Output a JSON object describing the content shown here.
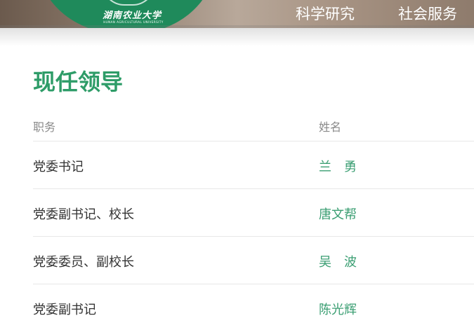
{
  "header": {
    "logo_cn": "湖南农业大学",
    "logo_en": "HUNAN AGRICULTURAL UNIVERSITY",
    "nav": [
      "科学研究",
      "社会服务"
    ]
  },
  "section": {
    "title": "现任领导",
    "columns": [
      "职务",
      "姓名"
    ],
    "rows": [
      {
        "role": "党委书记",
        "name": "兰　勇"
      },
      {
        "role": "党委副书记、校长",
        "name": "唐文帮"
      },
      {
        "role": "党委委员、副校长",
        "name": "吴　波"
      },
      {
        "role": "党委副书记",
        "name": "陈光辉"
      }
    ]
  },
  "colors": {
    "brand_green": "#1f8a5b",
    "title_green": "#2e9c68",
    "name_green": "#3a9e72"
  }
}
